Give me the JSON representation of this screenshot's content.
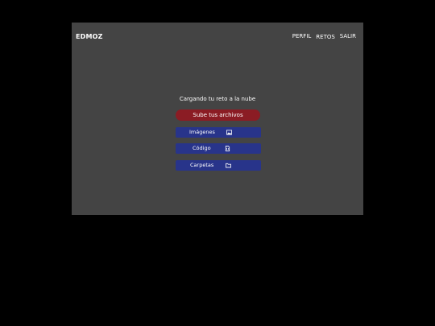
{
  "nav": {
    "brand": "EDMOZ",
    "links": [
      "PERFIL",
      "RETOS",
      "SALIR"
    ]
  },
  "main": {
    "status": "Cargando tu reto a la nube",
    "upload_label": "Sube tus archivos",
    "options": [
      {
        "label": "Imágenes",
        "icon": "image-icon"
      },
      {
        "label": "Código",
        "icon": "file-code-icon"
      },
      {
        "label": "Carpetas",
        "icon": "folder-icon"
      }
    ]
  },
  "colors": {
    "background": "#000000",
    "panel": "#444444",
    "upload_button": "#8b1c24",
    "option_button": "#28348a",
    "text": "#ffffff"
  }
}
